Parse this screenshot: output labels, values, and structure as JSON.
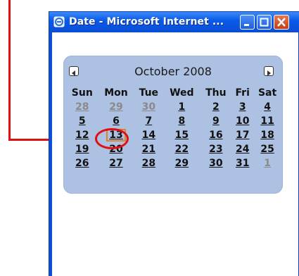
{
  "window": {
    "title": "Date - Microsoft Internet ...",
    "controls": {
      "minimize": "minimize",
      "maximize": "maximize",
      "close": "close"
    }
  },
  "calendar": {
    "month_label": "October 2008",
    "prev_icon": "left-triangle-icon",
    "next_icon": "right-triangle-icon",
    "weekdays": [
      "Sun",
      "Mon",
      "Tue",
      "Wed",
      "Thu",
      "Fri",
      "Sat"
    ],
    "weeks": [
      [
        {
          "d": "28",
          "other": true
        },
        {
          "d": "29",
          "other": true
        },
        {
          "d": "30",
          "other": true
        },
        {
          "d": "1"
        },
        {
          "d": "2"
        },
        {
          "d": "3"
        },
        {
          "d": "4"
        }
      ],
      [
        {
          "d": "5"
        },
        {
          "d": "6"
        },
        {
          "d": "7"
        },
        {
          "d": "8"
        },
        {
          "d": "9"
        },
        {
          "d": "10"
        },
        {
          "d": "11"
        }
      ],
      [
        {
          "d": "12"
        },
        {
          "d": "13",
          "today": true
        },
        {
          "d": "14"
        },
        {
          "d": "15"
        },
        {
          "d": "16"
        },
        {
          "d": "17"
        },
        {
          "d": "18"
        }
      ],
      [
        {
          "d": "19"
        },
        {
          "d": "20"
        },
        {
          "d": "21"
        },
        {
          "d": "22"
        },
        {
          "d": "23"
        },
        {
          "d": "24"
        },
        {
          "d": "25"
        }
      ],
      [
        {
          "d": "26"
        },
        {
          "d": "27"
        },
        {
          "d": "28"
        },
        {
          "d": "29"
        },
        {
          "d": "30"
        },
        {
          "d": "31"
        },
        {
          "d": "1",
          "other": true
        }
      ]
    ]
  },
  "colors": {
    "annotation": "#e01010",
    "calendar_bg": "#adc1e3",
    "today_outline": "#e0802a",
    "titlebar": "#0b5bea"
  }
}
